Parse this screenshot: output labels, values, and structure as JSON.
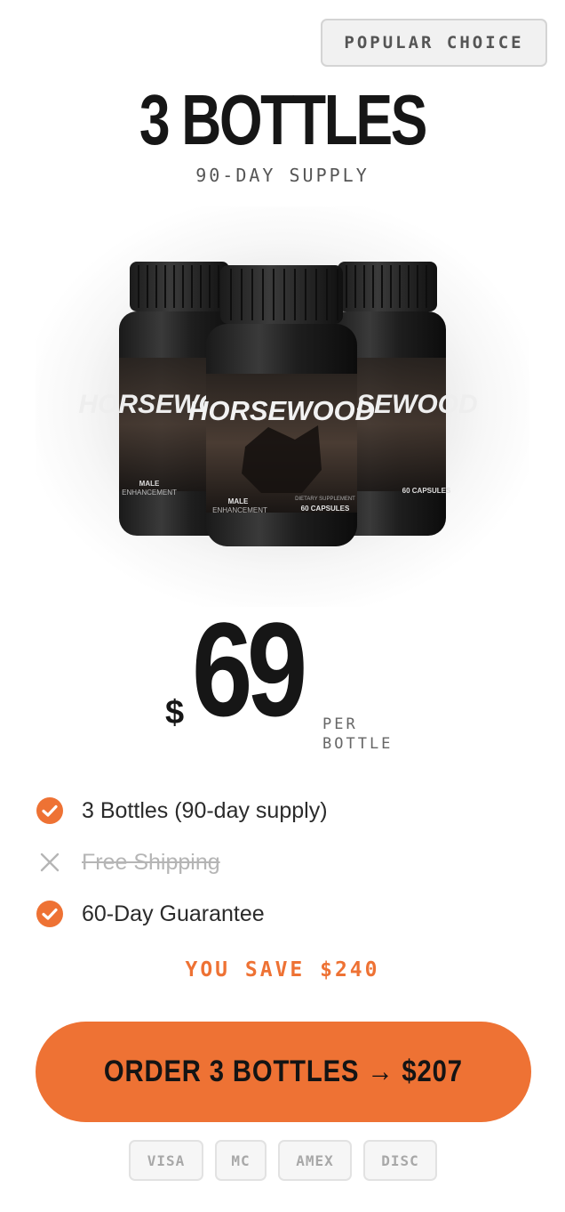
{
  "badge": "POPULAR CHOICE",
  "title": "3 BOTTLES",
  "subtitle": "90-DAY SUPPLY",
  "product": {
    "brand": "HORSEWOOD",
    "label_left": "MALE",
    "label_left_sub": "ENHANCEMENT",
    "label_right_small": "DIETARY SUPPLEMENT",
    "label_right": "60 CAPSULES"
  },
  "price": {
    "currency": "$",
    "amount": "69",
    "unit_line1": "PER",
    "unit_line2": "BOTTLE"
  },
  "features": [
    {
      "text": "3 Bottles (90-day supply)",
      "included": true,
      "icon": "check-circle-icon"
    },
    {
      "text": "Free Shipping",
      "included": false,
      "icon": "x-icon"
    },
    {
      "text": "60-Day Guarantee",
      "included": true,
      "icon": "check-circle-icon"
    }
  ],
  "savings": "YOU SAVE $240",
  "cta": "ORDER 3 BOTTLES → $207",
  "payments": [
    "VISA",
    "MC",
    "AMEX",
    "DISC"
  ],
  "colors": {
    "accent": "#ee7234",
    "text": "#161616",
    "muted": "#b5b5b5"
  }
}
